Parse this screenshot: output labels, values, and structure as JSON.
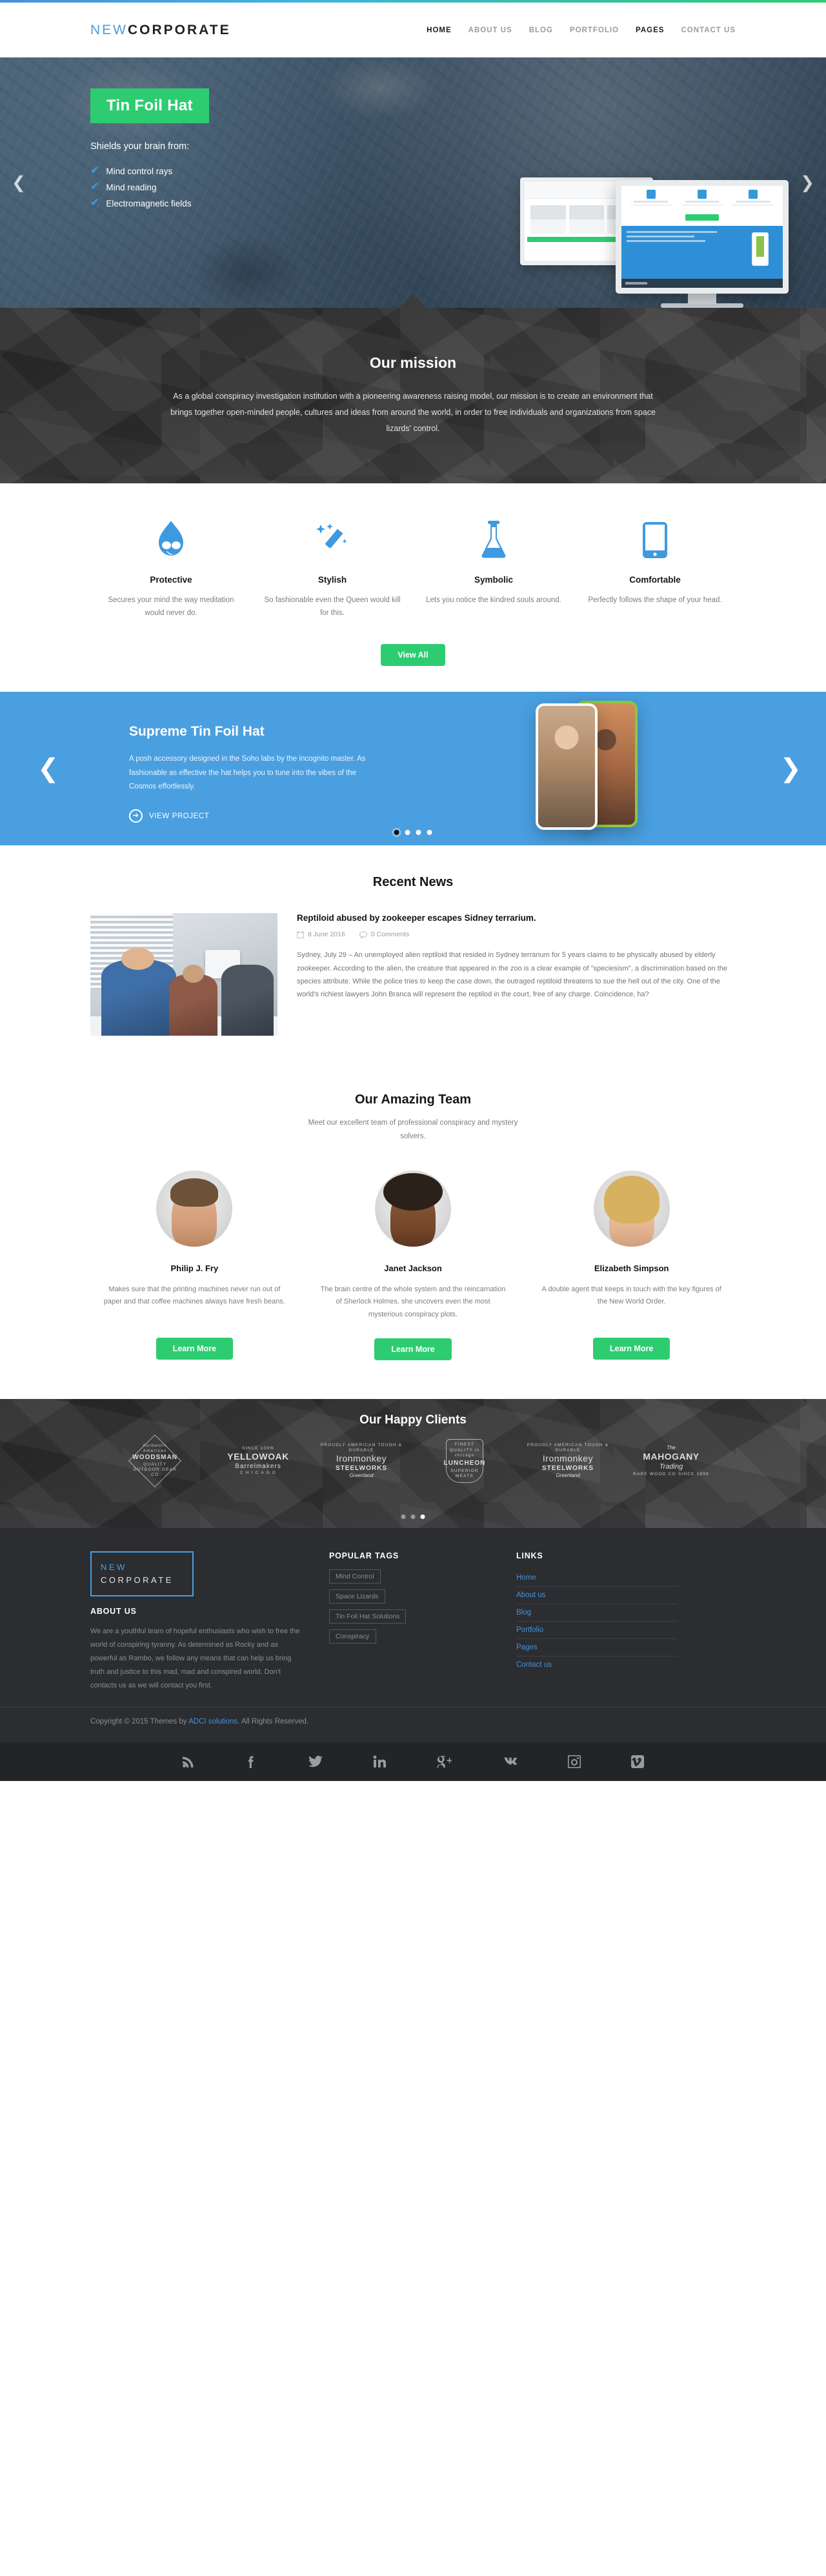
{
  "header": {
    "logo_part1": "NEW",
    "logo_part2": "CORPORATE",
    "nav": [
      {
        "label": "HOME",
        "active": true
      },
      {
        "label": "ABOUT US",
        "active": false
      },
      {
        "label": "BLOG",
        "active": false
      },
      {
        "label": "PORTFOLIO",
        "active": false
      },
      {
        "label": "PAGES",
        "active": true
      },
      {
        "label": "CONTACT US",
        "active": false
      }
    ]
  },
  "hero": {
    "badge": "Tin Foil Hat",
    "subtitle": "Shields your brain from:",
    "items": [
      "Mind control rays",
      "Mind reading",
      "Electromagnetic fields"
    ],
    "prev_icon": "chevron-left-icon",
    "next_icon": "chevron-right-icon"
  },
  "mission": {
    "title": "Our mission",
    "text": "As a global conspiracy investigation institution with a pioneering awareness raising model, our mission is to create an environment that brings together open-minded people, cultures and  ideas from around the world, in order to free individuals and organizations from space  lizards' control."
  },
  "features": {
    "items": [
      {
        "icon": "water-drop-icon",
        "title": "Protective",
        "text": "Secures your mind the way meditation would never do."
      },
      {
        "icon": "magic-wand-icon",
        "title": "Stylish",
        "text": "So fashionable even the Queen would kill for this."
      },
      {
        "icon": "flask-icon",
        "title": "Symbolic",
        "text": "Lets you notice the kindred souls around."
      },
      {
        "icon": "tablet-icon",
        "title": "Comfortable",
        "text": "Perfectly follows the shape of your head."
      }
    ],
    "view_all": "View All"
  },
  "showcase": {
    "title": "Supreme Tin Foil Hat",
    "text": "A posh accessory designed in the Soho labs by the incognito master. As fashionable as effective the hat helps you to tune into the vibes of the Cosmos effortlessly.",
    "cta": "VIEW PROJECT",
    "dots": 4,
    "active_dot": 0
  },
  "news": {
    "section_title": "Recent News",
    "post": {
      "title": "Reptiloid abused by zookeeper escapes Sidney terrarium.",
      "date": "8 June 2016",
      "comments": "0 Comments",
      "body": "Sydney, July 29 – An unemployed alien reptiloid that resided in Sydney terrarium for 5 years claims to be physically abused by elderly zookeeper. According to the alien, the creature that appeared in the zoo is a clear example of \"speciesism\", a discrimination based on the species attribute. While the police tries to keep the case down, the outraged reptiloid threatens to sue the hell out of the city. One of the world's richiest lawyers John Branca will represent the reptilod in the court, free of any charge. Coincidence, ha?"
    }
  },
  "team": {
    "section_title": "Our Amazing Team",
    "subtitle": "Meet our excellent team of professional conspiracy and mystery solvers.",
    "members": [
      {
        "name": "Philip J. Fry",
        "text": "Makes sure that the printing machines never run out of paper and that coffee machines always have fresh beans.",
        "button": "Learn More"
      },
      {
        "name": "Janet Jackson",
        "text": "The brain centre of the whole system and the reincarnation of Sherlock Holmes, she uncovers even the most mysterious conspiracy plots.",
        "button": "Learn More"
      },
      {
        "name": "Elizabeth Simpson",
        "text": "A double agent that keeps in touch with the key figures of the New World Order.",
        "button": "Learn More"
      }
    ]
  },
  "clients": {
    "section_title": "Our Happy Clients",
    "logos": [
      {
        "top": "Authentic American",
        "main": "WOODSMAN",
        "sub": "QUALITY OUTDOOR GEAR",
        "foot": "CO"
      },
      {
        "top": "SINCE        100%",
        "main": "YELLOWOAK",
        "sub": "Barrelmakers",
        "foot": "C H I C A G O"
      },
      {
        "top": "PROUDLY AMERICAN   TOUGH & DURABLE",
        "main": "Ironmonkey",
        "sub": "STEELWORKS",
        "foot": "Greenland"
      },
      {
        "top": "FINEST QUALITY in chicago",
        "main": "LUNCHEON",
        "sub": "SUPERIOR MEATS",
        "foot": ""
      },
      {
        "top": "PROUDLY AMERICAN   TOUGH & DURABLE",
        "main": "Ironmonkey",
        "sub": "STEELWORKS",
        "foot": "Greenland"
      },
      {
        "top": "The",
        "main": "MAHOGANY",
        "sub": "Trading",
        "foot": "RARE WOOD   CO   SINCE 1899"
      }
    ],
    "dots": 3,
    "active_dot": 2
  },
  "footer": {
    "logo_part1": "NEW",
    "logo_part2": "CORPORATE",
    "about_title": "ABOUT US",
    "about_text": "We are a youthful team of hopeful enthusiasts who wish to free the world of conspiring tyranny.  As determined as Rocky and as powerful as Rambo, we follow any means that can help us bring truth and justice to this mad, mad and conspired world. Don't contacts us as we will contact you first.",
    "tags_title": "POPULAR TAGS",
    "tags": [
      "Mind Control",
      "Space Lizards",
      "Tin Foil Hat Solutions",
      "Conspiracy"
    ],
    "links_title": "LINKS",
    "links": [
      "Home",
      "About us",
      "Blog",
      "Portfolio",
      "Pages",
      "Contact us"
    ],
    "copyright_prefix": "Copyright © 2015 Themes by ",
    "copyright_link": "ADCI solutions",
    "copyright_suffix": ". All Rights Reserved.",
    "social": [
      "rss-icon",
      "facebook-icon",
      "twitter-icon",
      "linkedin-icon",
      "googleplus-icon",
      "vk-icon",
      "instagram-icon",
      "vimeo-icon"
    ]
  },
  "colors": {
    "accent_blue": "#4a9fe0",
    "accent_green": "#2ecc71",
    "dark": "#2b2d31"
  }
}
